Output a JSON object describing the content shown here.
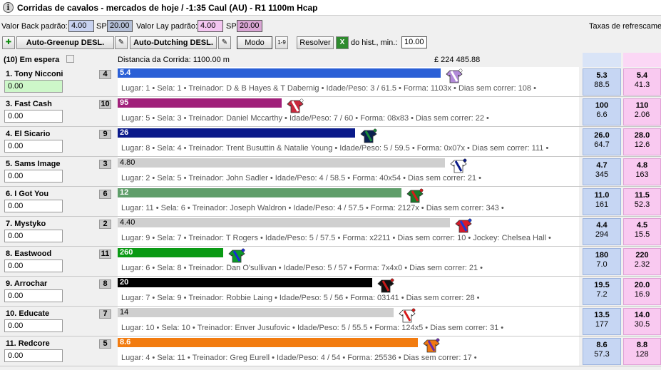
{
  "header": {
    "title": "Corridas de cavalos - mercados de hoje / -1:35 Caul (AU) - R1 1100m Hcap"
  },
  "toolbar": {
    "back_label": "Valor Back padrão:",
    "back_value": "4.00",
    "sp_label": "SP",
    "back_sp_value": "20.00",
    "lay_label": "Valor Lay padrão:",
    "lay_value": "4.00",
    "lay_sp_value": "20.00",
    "refresh_label": "Taxas de refrescame",
    "autogreenup_label": "Auto-Greenup DESL.",
    "autodutching_label": "Auto-Dutching DESL.",
    "modo_label": "Modo",
    "modo_icon_text": "1-9",
    "resolver_label": "Resolver",
    "hist_label": "do hist., min.:",
    "hist_value": "10.00"
  },
  "race": {
    "waiting": "(10) Em espera",
    "distance": "Distancia da Corrida: 1100.00 m",
    "matched": "£ 224 485.88"
  },
  "runners": [
    {
      "name": "1. Tony Nicconi",
      "num": "4",
      "pl": "0.00",
      "bar_label": "5.4",
      "bar_fraction": 0.7,
      "bar_color": "#2a5fd6",
      "info": "Lugar: 1  •  Sela: 1  •  Treinador: D & B Hayes & T Dabernig  •  Idade/Peso: 3 / 61.5  •  Forma: 1103x  •  Dias sem correr: 108  •",
      "back_price": "5.3",
      "back_size": "88.5",
      "lay_price": "5.4",
      "lay_size": "41.3",
      "silk_icon": "purple-white-diagonal-silk-icon"
    },
    {
      "name": "3. Fast Cash",
      "num": "10",
      "pl": "0.00",
      "bar_label": "95",
      "bar_fraction": 0.355,
      "bar_color": "#a0207a",
      "info": "Lugar: 5  •  Sela: 3  •  Treinador: Daniel Mccarthy  •  Idade/Peso: 7 / 60  •  Forma: 08x83  •  Dias sem correr: 22  •",
      "back_price": "100",
      "back_size": "6.6",
      "lay_price": "110",
      "lay_size": "2.06",
      "silk_icon": "red-white-check-silk-icon"
    },
    {
      "name": "4. El Sicario",
      "num": "9",
      "pl": "0.00",
      "bar_label": "26",
      "bar_fraction": 0.515,
      "bar_color": "#0a1a8a",
      "info": "Lugar: 8  •  Sela: 4  •  Treinador: Trent Busuttin & Natalie Young  •  Idade/Peso: 5 / 59.5  •  Forma: 0x07x  •  Dias sem correr: 111  •",
      "back_price": "26.0",
      "back_size": "64.7",
      "lay_price": "28.0",
      "lay_size": "12.6",
      "silk_icon": "navy-green-silk-icon"
    },
    {
      "name": "5. Sams Image",
      "num": "3",
      "pl": "0.00",
      "bar_label": "4.80",
      "bar_fraction": 0.71,
      "bar_color": "#cfcfcf",
      "info": "Lugar: 2  •  Sela: 5  •  Treinador: John Sadler  •  Idade/Peso: 4 / 58.5  •  Forma: 40x54  •  Dias sem correr: 21  •",
      "back_price": "4.7",
      "back_size": "345",
      "lay_price": "4.8",
      "lay_size": "163",
      "silk_icon": "white-navy-check-silk-icon"
    },
    {
      "name": "6. I Got You",
      "num": "6",
      "pl": "0.00",
      "bar_label": "12",
      "bar_fraction": 0.615,
      "bar_color": "#5f9e6a",
      "info": "Lugar: 11  •  Sela: 6  •  Treinador: Joseph Waldron  •  Idade/Peso: 4 / 57.5  •  Forma: 2127x  •  Dias sem correr: 343  •",
      "back_price": "11.0",
      "back_size": "161",
      "lay_price": "11.5",
      "lay_size": "52.3",
      "silk_icon": "green-red-cap-silk-icon"
    },
    {
      "name": "7. Mystyko",
      "num": "2",
      "pl": "0.00",
      "bar_label": "4.40",
      "bar_fraction": 0.72,
      "bar_color": "#cfcfcf",
      "info": "Lugar: 9  •  Sela: 7  •  Treinador: T Rogers  •  Idade/Peso: 5 / 57.5  •  Forma: x2211  •  Dias sem correr: 10  •  Jockey: Chelsea Hall  •",
      "back_price": "4.4",
      "back_size": "294",
      "lay_price": "4.5",
      "lay_size": "15.5",
      "silk_icon": "red-blue-white-silk-icon"
    },
    {
      "name": "8. Eastwood",
      "num": "11",
      "pl": "0.00",
      "bar_label": "260",
      "bar_fraction": 0.228,
      "bar_color": "#0a9a14",
      "info": "Lugar: 6  •  Sela: 8  •  Treinador: Dan O'sullivan  •  Idade/Peso: 5 / 57  •  Forma: 7x4x0  •  Dias sem correr: 21  •",
      "back_price": "180",
      "back_size": "7.0",
      "lay_price": "220",
      "lay_size": "2.32",
      "silk_icon": "green-blue-silk-icon"
    },
    {
      "name": "9. Arrochar",
      "num": "8",
      "pl": "0.00",
      "bar_label": "20",
      "bar_fraction": 0.552,
      "bar_color": "#000000",
      "info": "Lugar: 7  •  Sela: 9  •  Treinador: Robbie Laing  •  Idade/Peso: 5 / 56  •  Forma: 03141  •  Dias sem correr: 28  •",
      "back_price": "19.5",
      "back_size": "7.2",
      "lay_price": "20.0",
      "lay_size": "16.9",
      "silk_icon": "black-red-silk-icon"
    },
    {
      "name": "10. Educate",
      "num": "7",
      "pl": "0.00",
      "bar_label": "14",
      "bar_fraction": 0.598,
      "bar_color": "#cfcfcf",
      "info": "Lugar: 10  •  Sela: 10  •  Treinador: Enver Jusufovic  •  Idade/Peso: 5 / 55.5  •  Forma: 124x5  •  Dias sem correr: 31  •",
      "back_price": "13.5",
      "back_size": "177",
      "lay_price": "14.0",
      "lay_size": "30.5",
      "silk_icon": "white-red-stripe-silk-icon"
    },
    {
      "name": "11. Redcore",
      "num": "5",
      "pl": "0.00",
      "bar_label": "8.6",
      "bar_fraction": 0.65,
      "bar_color": "#f27c10",
      "info": "Lugar: 4  •  Sela: 11  •  Treinador: Greg Eurell  •  Idade/Peso: 4 / 54  •  Forma: 25536  •  Dias sem correr: 17  •",
      "back_price": "8.6",
      "back_size": "57.3",
      "lay_price": "8.8",
      "lay_size": "128",
      "silk_icon": "orange-white-purple-silk-icon"
    }
  ],
  "colors": {
    "back": "#c6d6f3",
    "lay": "#f9c9f0",
    "back_box": "#c8d2f0",
    "lay_box": "#f3c6f1"
  }
}
